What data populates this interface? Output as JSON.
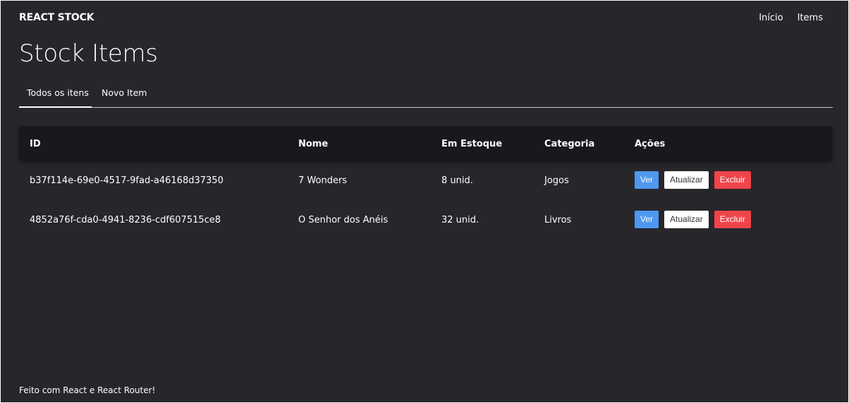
{
  "header": {
    "brand": "REACT STOCK",
    "nav": [
      "Início",
      "Items"
    ]
  },
  "page": {
    "title": "Stock Items"
  },
  "tabs": [
    "Todos os itens",
    "Novo Item"
  ],
  "table": {
    "columns": [
      "ID",
      "Nome",
      "Em Estoque",
      "Categoria",
      "Ações"
    ],
    "rows": [
      {
        "id": "b37f114e-69e0-4517-9fad-a46168d37350",
        "name": "7 Wonders",
        "stock": "8 unid.",
        "category": "Jogos"
      },
      {
        "id": "4852a76f-cda0-4941-8236-cdf607515ce8",
        "name": "O Senhor dos Anéis",
        "stock": "32 unid.",
        "category": "Livros"
      }
    ],
    "actions": {
      "view": "Ver",
      "update": "Atualizar",
      "delete": "Excluir"
    }
  },
  "footer": {
    "text": "Feito com React e React Router!"
  },
  "colors": {
    "background": "#27262b",
    "table_header": "#19181c",
    "view_button": "#4f98f0",
    "delete_button": "#f0444b"
  }
}
